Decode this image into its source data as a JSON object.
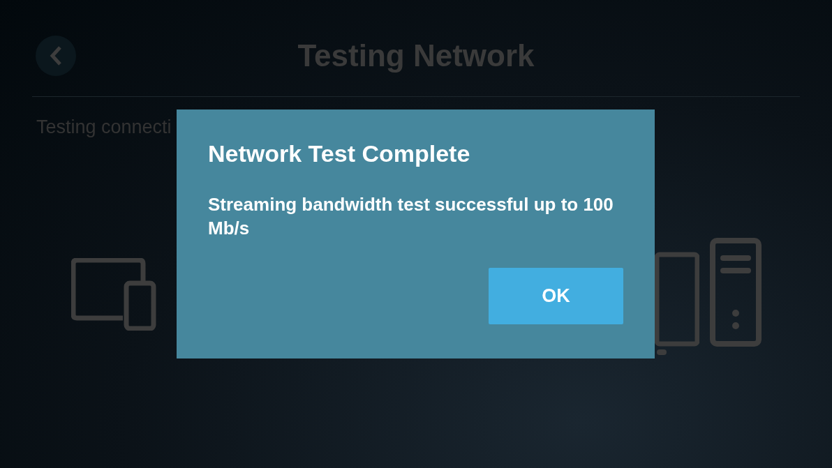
{
  "screen": {
    "title": "Testing Network",
    "status_text": "Testing connecti"
  },
  "dialog": {
    "title": "Network Test Complete",
    "message": "Streaming bandwidth test successful up to 100 Mb/s",
    "buttons": [
      "OK"
    ]
  }
}
